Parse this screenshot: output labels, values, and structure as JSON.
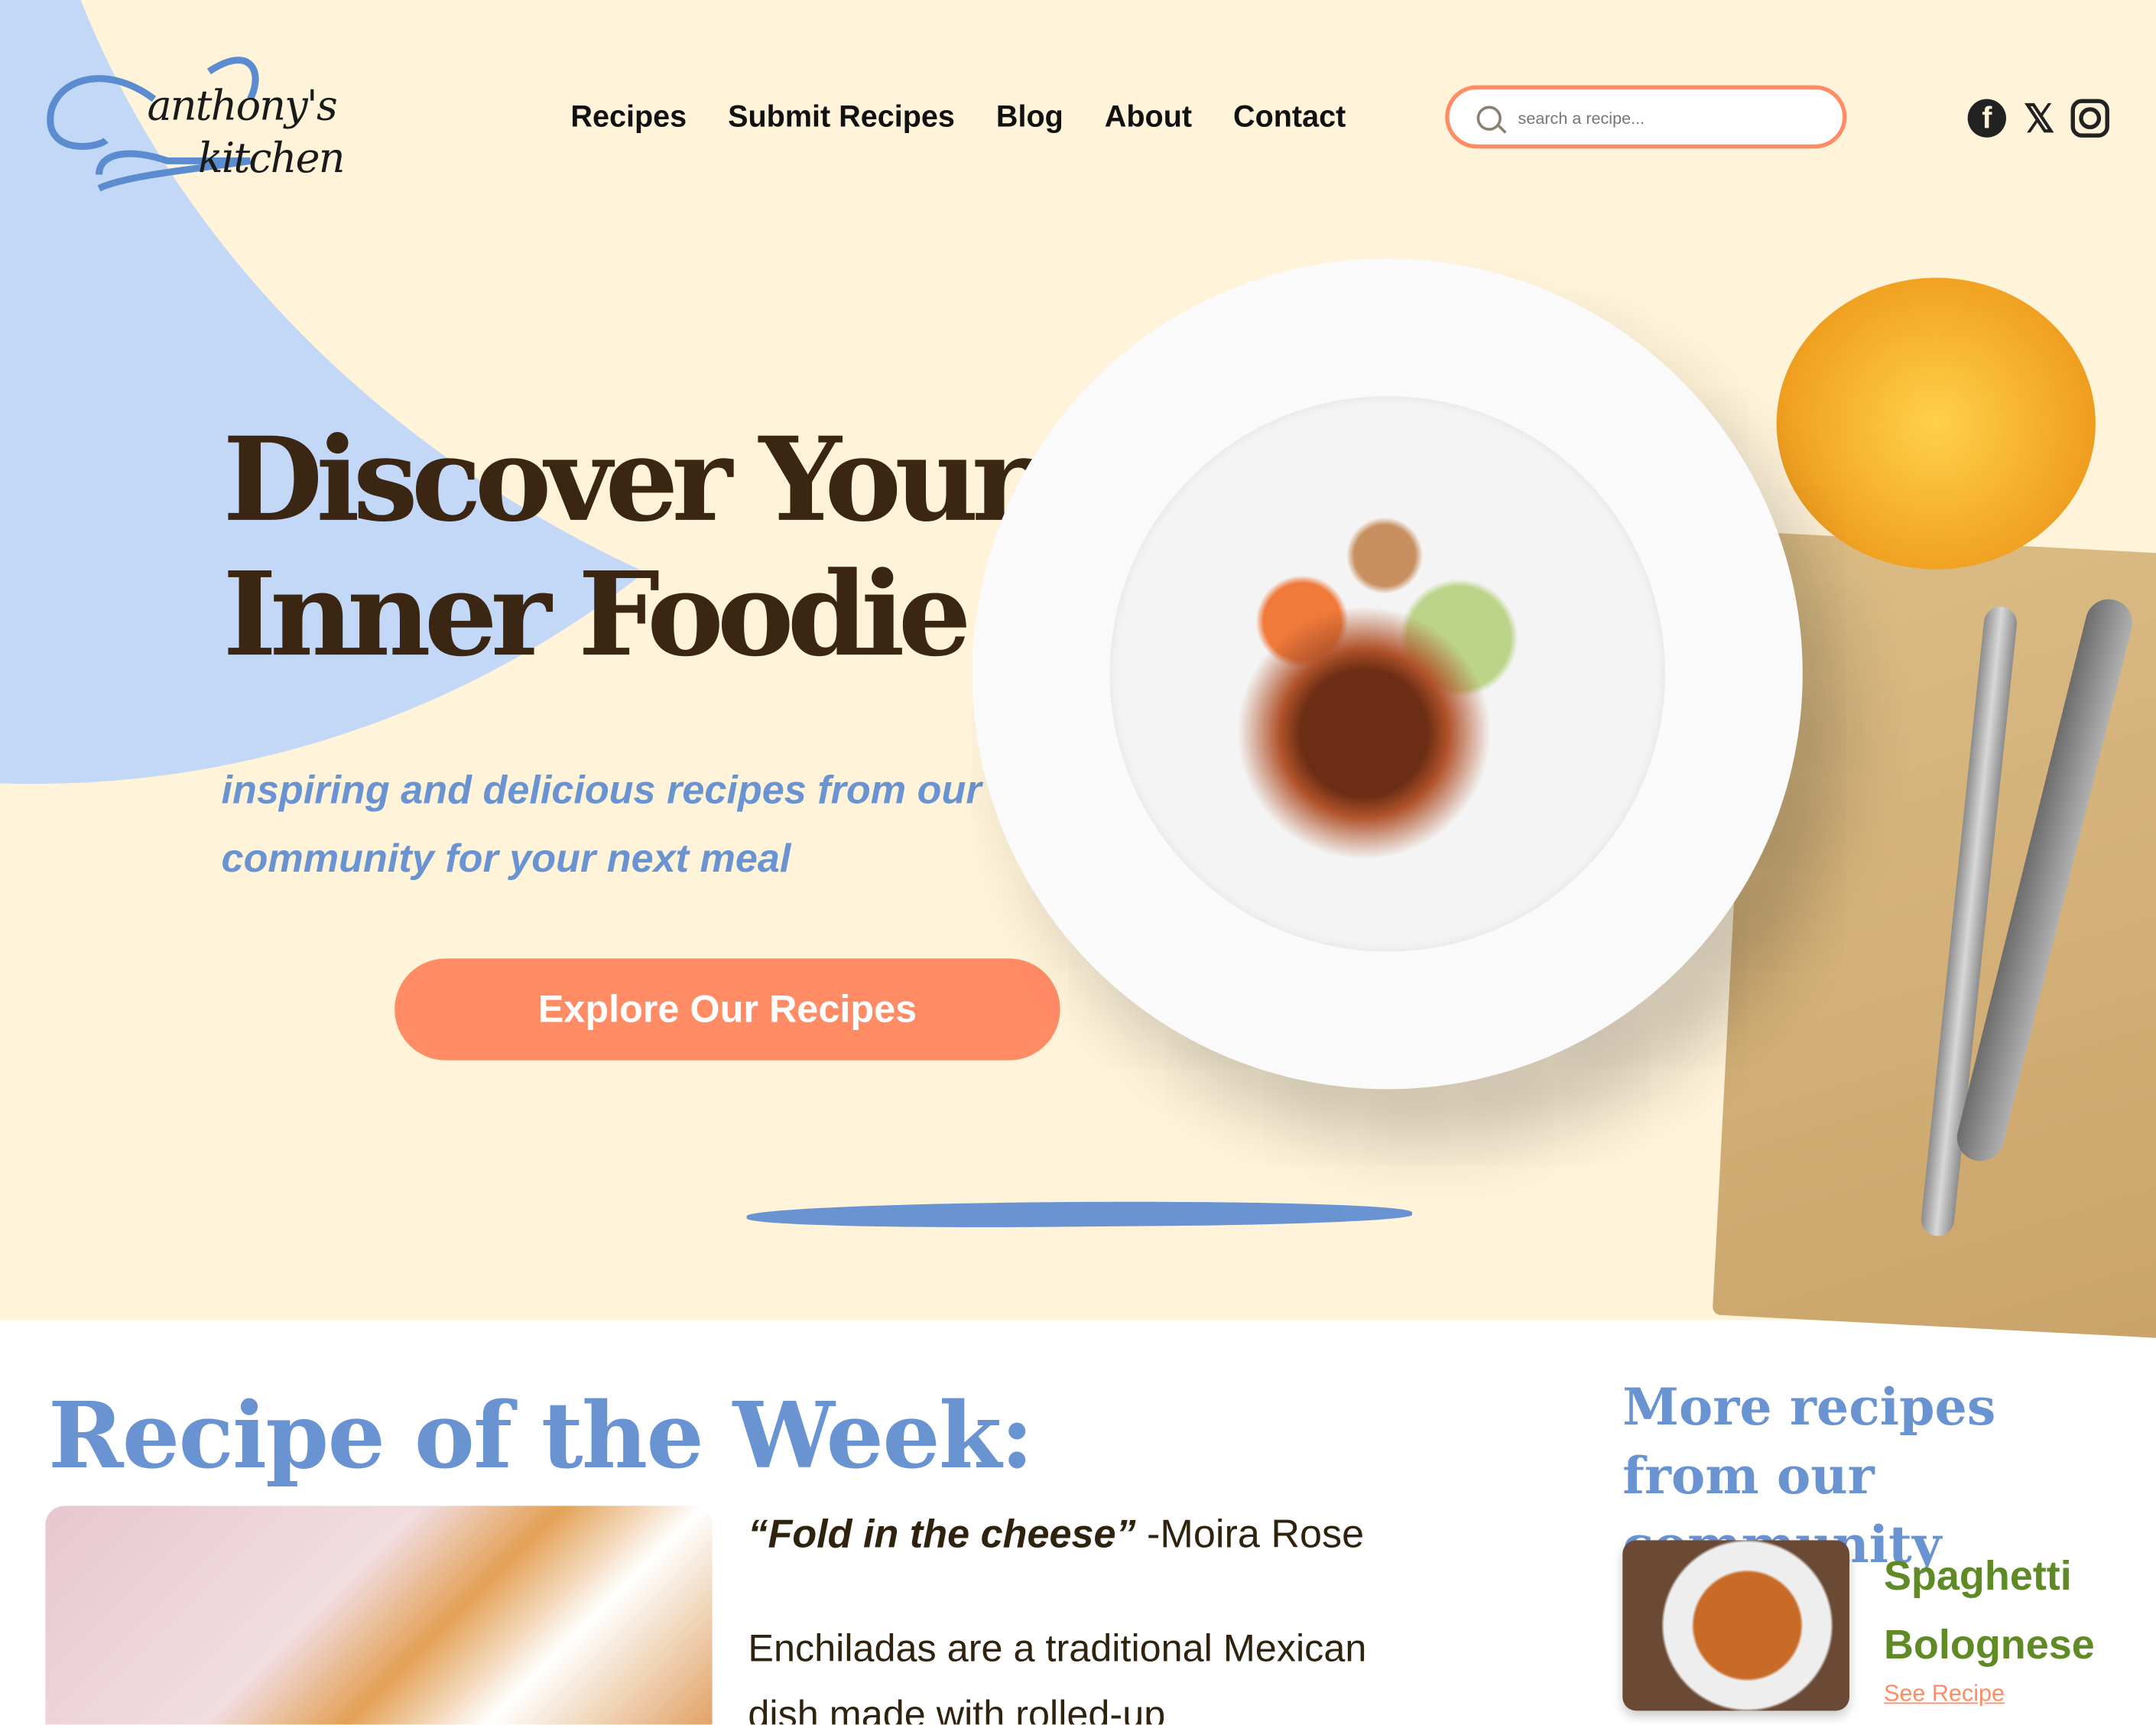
{
  "logo": {
    "line1": "anthony's",
    "line2": "kitchen"
  },
  "nav": {
    "items": [
      {
        "label": "Recipes"
      },
      {
        "label": "Submit Recipes"
      },
      {
        "label": "Blog"
      },
      {
        "label": "About"
      },
      {
        "label": "Contact"
      }
    ]
  },
  "search": {
    "placeholder": "search a recipe...",
    "value": ""
  },
  "social": {
    "icons": [
      "facebook-icon",
      "x-icon",
      "instagram-icon"
    ],
    "facebook_glyph": "f",
    "x_glyph": "𝕏"
  },
  "hero": {
    "title_line1": "Discover Your",
    "title_line2": "Inner Foodie !",
    "tagline": "inspiring and delicious recipes from our community for your next meal",
    "cta_label": "Explore Our Recipes"
  },
  "recipe_of_week": {
    "heading": "Recipe of the Week:",
    "quote": "“Fold in the cheese”",
    "quote_author": " -Moira Rose",
    "description": "Enchiladas are a traditional Mexican dish made with rolled-up"
  },
  "more_recipes": {
    "heading": "More recipes from our community",
    "cards": [
      {
        "title": "Spaghetti Bolognese",
        "link": "See Recipe"
      }
    ]
  },
  "colors": {
    "cream": "#fff3d9",
    "blue": "#6a93d2",
    "light_blue": "#c3d8f7",
    "accent": "#ff8c65",
    "brown": "#3a2612",
    "green": "#5f8a26"
  }
}
